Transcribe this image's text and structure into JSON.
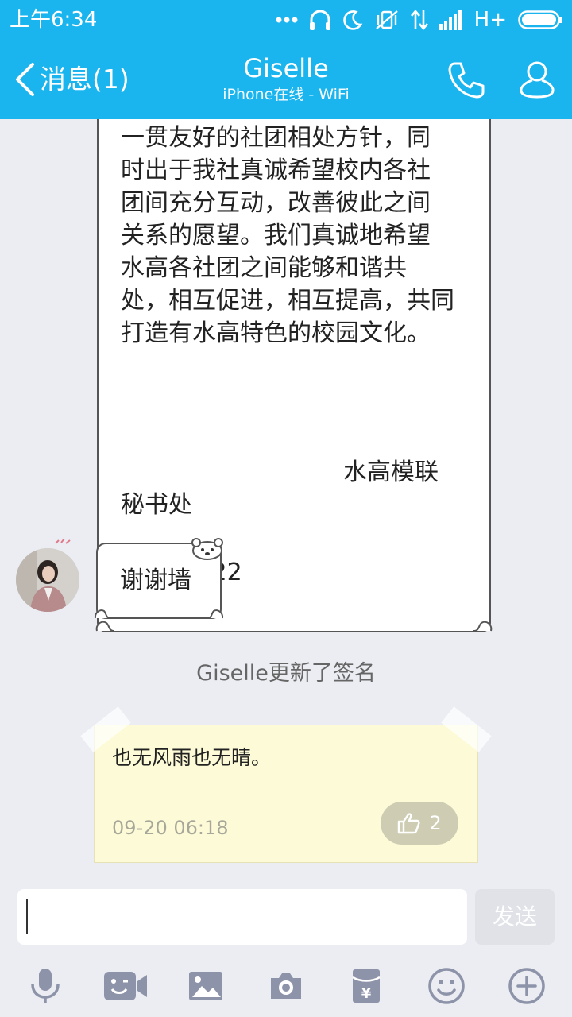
{
  "status_bar": {
    "time": "上午6:34",
    "network": "H+"
  },
  "header": {
    "back_label": "消息(1)",
    "title": "Giselle",
    "subtitle": "iPhone在线 - WiFi"
  },
  "messages": {
    "big": {
      "lines": [
        "一贯友好的社团相处方针，同",
        "时出于我社真诚希望校内各社",
        "团间充分互动，改善彼此之间",
        "关系的愿望。我们真诚地希望",
        "水高各社团之间能够和谐共",
        "处，相互促进，相互提高，共同",
        "打造有水高特色的校园文化。"
      ],
      "signature_line1": "水高模联",
      "signature_line2": "秘书处",
      "date": "2016.9.22"
    },
    "small": {
      "text": "谢谢墙"
    },
    "system_note": "Giselle更新了签名",
    "signature_card": {
      "text": "也无风雨也无晴。",
      "time": "09-20 06:18",
      "likes": "2"
    }
  },
  "input": {
    "value": "",
    "placeholder": "",
    "send_label": "发送"
  },
  "toolbar": {
    "items": [
      "microphone-icon",
      "video-emoji-icon",
      "image-icon",
      "camera-icon",
      "red-packet-icon",
      "emoji-icon",
      "plus-icon"
    ]
  },
  "colors": {
    "header": "#1ab4ee",
    "background": "#ebedf2",
    "note_card": "#fdfbd7",
    "toolbar_icon": "#8d93a9"
  }
}
